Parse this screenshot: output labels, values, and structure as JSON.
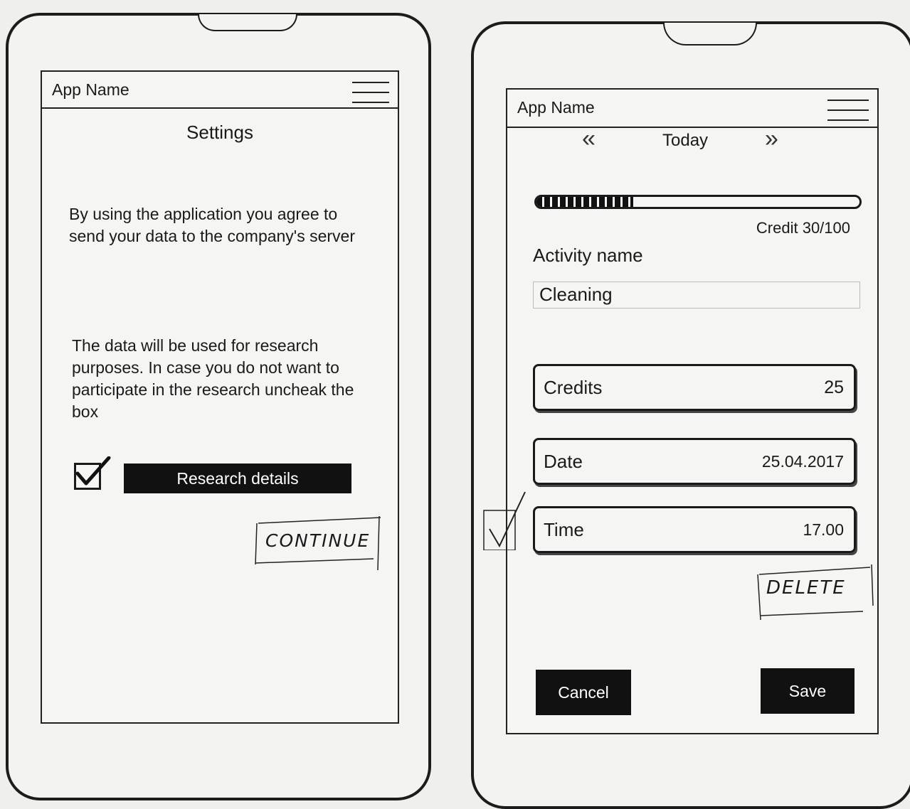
{
  "left_screen": {
    "app_name": "App Name",
    "heading": "Settings",
    "consent_text": "By using the application you agree to send your data to the company's server",
    "research_text": "The data will be used for research purposes. In case you do not want to participate in the research uncheak the box",
    "research_checkbox_checked": true,
    "research_button_label": "Research details",
    "continue_label": "CONTINUE"
  },
  "right_screen": {
    "app_name": "App Name",
    "prev_icon": "double-chevron-left",
    "next_icon": "double-chevron-right",
    "day_label": "Today",
    "credit_progress": 0.3,
    "credit_label": "Credit 30/100",
    "activity_label": "Activity name",
    "activity_value": "Cleaning",
    "credits_label": "Credits",
    "credits_value": "25",
    "date_label": "Date",
    "date_value": "25.04.2017",
    "time_label": "Time",
    "time_value": "17.00",
    "delete_label": "DELETE",
    "cancel_label": "Cancel",
    "save_label": "Save"
  }
}
